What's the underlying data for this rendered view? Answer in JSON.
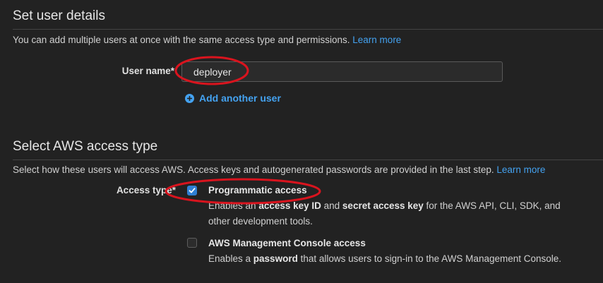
{
  "user_details": {
    "title": "Set user details",
    "description": "You can add multiple users at once with the same access type and permissions.",
    "learn_more": "Learn more",
    "username_label": "User name*",
    "username_value": "deployer",
    "add_another_user": "Add another user"
  },
  "access_type": {
    "title": "Select AWS access type",
    "description": "Select how these users will access AWS. Access keys and autogenerated passwords are provided in the last step.",
    "learn_more": "Learn more",
    "label": "Access type*",
    "options": [
      {
        "title": "Programmatic access",
        "checked": true,
        "desc_prefix": "Enables an ",
        "desc_bold1": "access key ID",
        "desc_mid": " and ",
        "desc_bold2": "secret access key",
        "desc_suffix": " for the AWS API, CLI, SDK, and",
        "desc_line2": "other development tools."
      },
      {
        "title": "AWS Management Console access",
        "checked": false,
        "desc_prefix": "Enables a ",
        "desc_bold1": "password",
        "desc_suffix": " that allows users to sign-in to the AWS Management Console."
      }
    ]
  },
  "colors": {
    "background": "#222222",
    "link": "#44a2f0",
    "checkbox_checked": "#2f7fd3",
    "annotation": "#d9141e"
  },
  "icons": {
    "add_user": "plus-circle-icon",
    "checkmark": "checkmark-icon"
  }
}
